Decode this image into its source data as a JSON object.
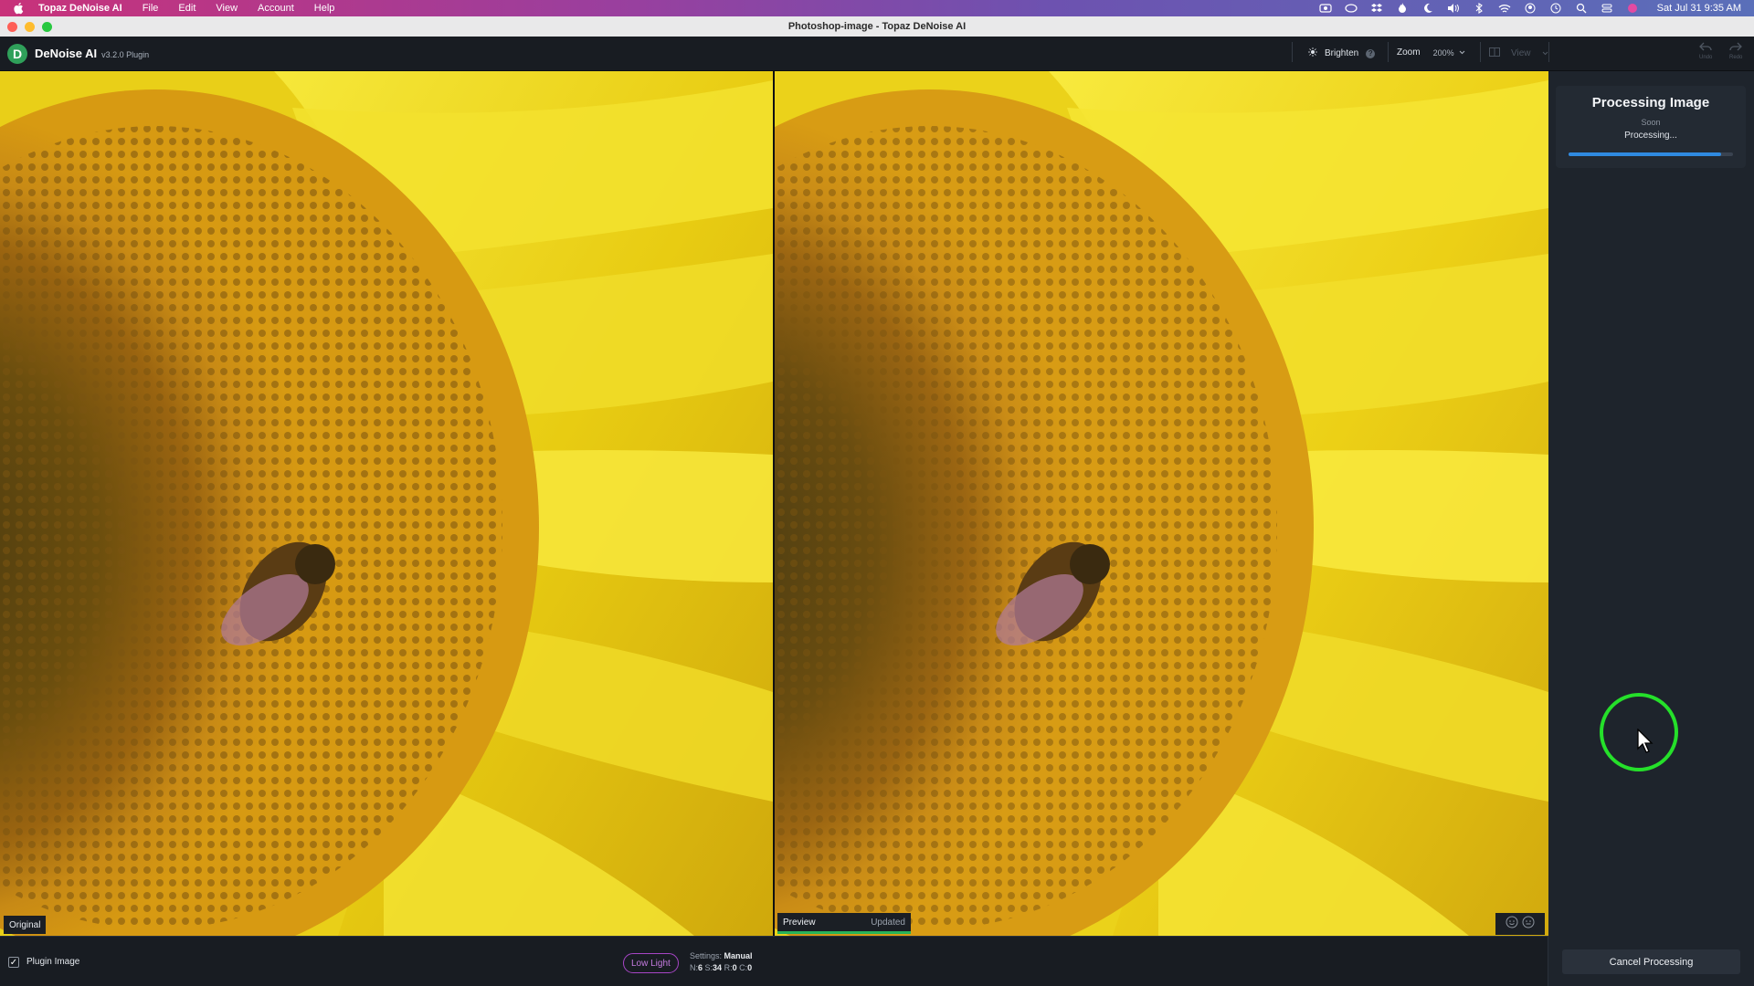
{
  "menubar": {
    "app_name": "Topaz DeNoise AI",
    "items": [
      "File",
      "Edit",
      "View",
      "Account",
      "Help"
    ],
    "clock": "Sat Jul 31  9:35 AM"
  },
  "window": {
    "title": "Photoshop-image - Topaz DeNoise AI"
  },
  "toolbar": {
    "app_name": "DeNoise AI",
    "version": "v3.2.0 Plugin",
    "brighten_label": "Brighten",
    "zoom_label": "Zoom",
    "zoom_value": "200%",
    "view_label": "View",
    "undo_label": "Undo",
    "redo_label": "Redo"
  },
  "panes": {
    "original_label": "Original",
    "preview_label": "Preview",
    "preview_status": "Updated"
  },
  "processing": {
    "title": "Processing Image",
    "eta": "Soon",
    "status": "Processing...",
    "progress": 0.93
  },
  "bottombar": {
    "plugin_image_label": "Plugin Image",
    "plugin_image_checked": true,
    "model_pill": "Low Light",
    "settings_prefix": "Settings:",
    "settings_mode": "Manual",
    "n_label": "N:",
    "n_value": "6",
    "s_label": "S:",
    "s_value": "34",
    "r_label": "R:",
    "r_value": "0",
    "c_label": "C:",
    "c_value": "0"
  },
  "cancel_button": "Cancel Processing",
  "colors": {
    "accent_blue": "#2f8ae0",
    "accent_green": "#27b35a",
    "pill_purple": "#a745c6"
  }
}
